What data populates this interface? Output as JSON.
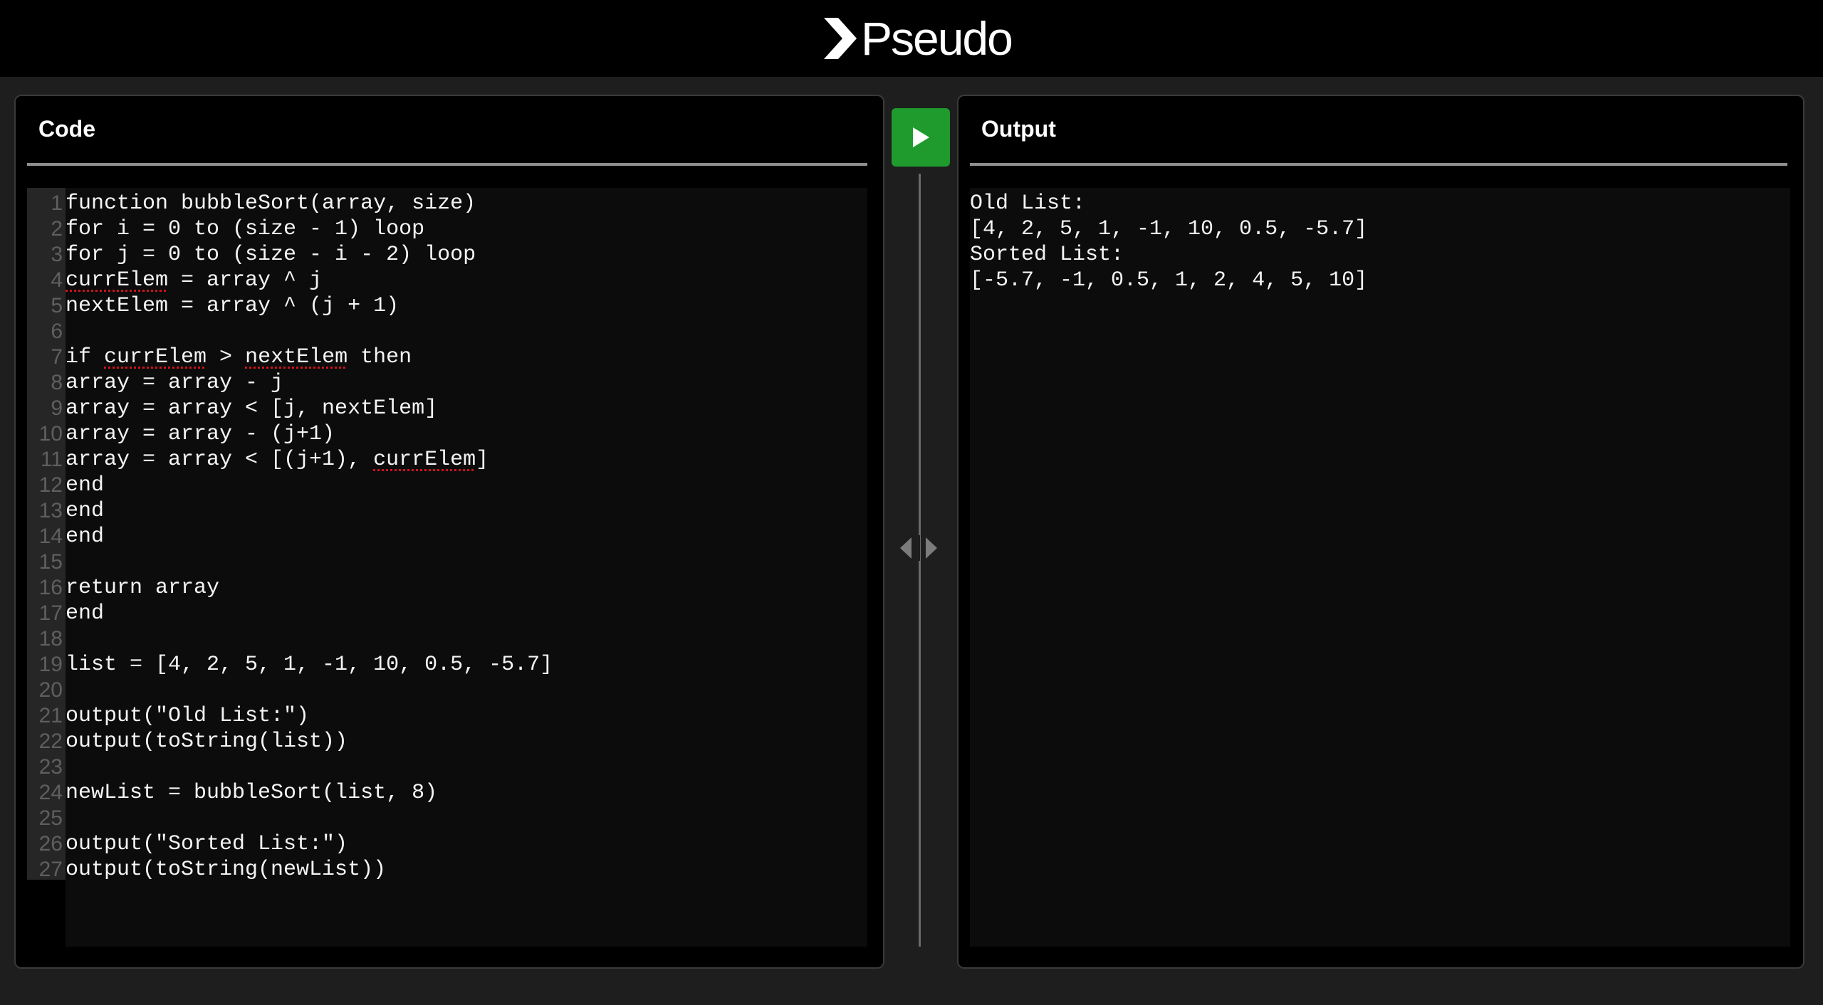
{
  "app": {
    "name": "Pseudo"
  },
  "code_panel": {
    "title": "Code",
    "lines": [
      {
        "n": "1",
        "text": "function bubbleSort(array, size)"
      },
      {
        "n": "2",
        "text": "for i = 0 to (size - 1) loop"
      },
      {
        "n": "3",
        "text": "for j = 0 to (size - i - 2) loop"
      },
      {
        "n": "4",
        "text": "currElem = array ^ j"
      },
      {
        "n": "5",
        "text": "nextElem = array ^ (j + 1)"
      },
      {
        "n": "6",
        "text": ""
      },
      {
        "n": "7",
        "text": "if currElem > nextElem then"
      },
      {
        "n": "8",
        "text": "array = array - j"
      },
      {
        "n": "9",
        "text": "array = array < [j, nextElem]"
      },
      {
        "n": "10",
        "text": "array = array - (j+1)"
      },
      {
        "n": "11",
        "text": "array = array < [(j+1), currElem]"
      },
      {
        "n": "12",
        "text": "end"
      },
      {
        "n": "13",
        "text": "end"
      },
      {
        "n": "14",
        "text": "end"
      },
      {
        "n": "15",
        "text": ""
      },
      {
        "n": "16",
        "text": "return array"
      },
      {
        "n": "17",
        "text": "end"
      },
      {
        "n": "18",
        "text": ""
      },
      {
        "n": "19",
        "text": "list = [4, 2, 5, 1, -1, 10, 0.5, -5.7]"
      },
      {
        "n": "20",
        "text": ""
      },
      {
        "n": "21",
        "text": "output(\"Old List:\")"
      },
      {
        "n": "22",
        "text": "output(toString(list))"
      },
      {
        "n": "23",
        "text": ""
      },
      {
        "n": "24",
        "text": "newList = bubbleSort(list, 8)"
      },
      {
        "n": "25",
        "text": ""
      },
      {
        "n": "26",
        "text": "output(\"Sorted List:\")"
      },
      {
        "n": "27",
        "text": "output(toString(newList))"
      }
    ]
  },
  "output_panel": {
    "title": "Output",
    "lines": [
      "Old List:",
      "[4, 2, 5, 1, -1, 10, 0.5, -5.7]",
      "Sorted List:",
      "[-5.7, -1, 0.5, 1, 2, 4, 5, 10]"
    ]
  },
  "icons": {
    "run": "play-icon",
    "resize": "resize-arrows-icon",
    "logo": "chevron-right-icon"
  },
  "colors": {
    "run_button": "#1f9b2e",
    "spellcheck_underline": "#d0121b"
  }
}
